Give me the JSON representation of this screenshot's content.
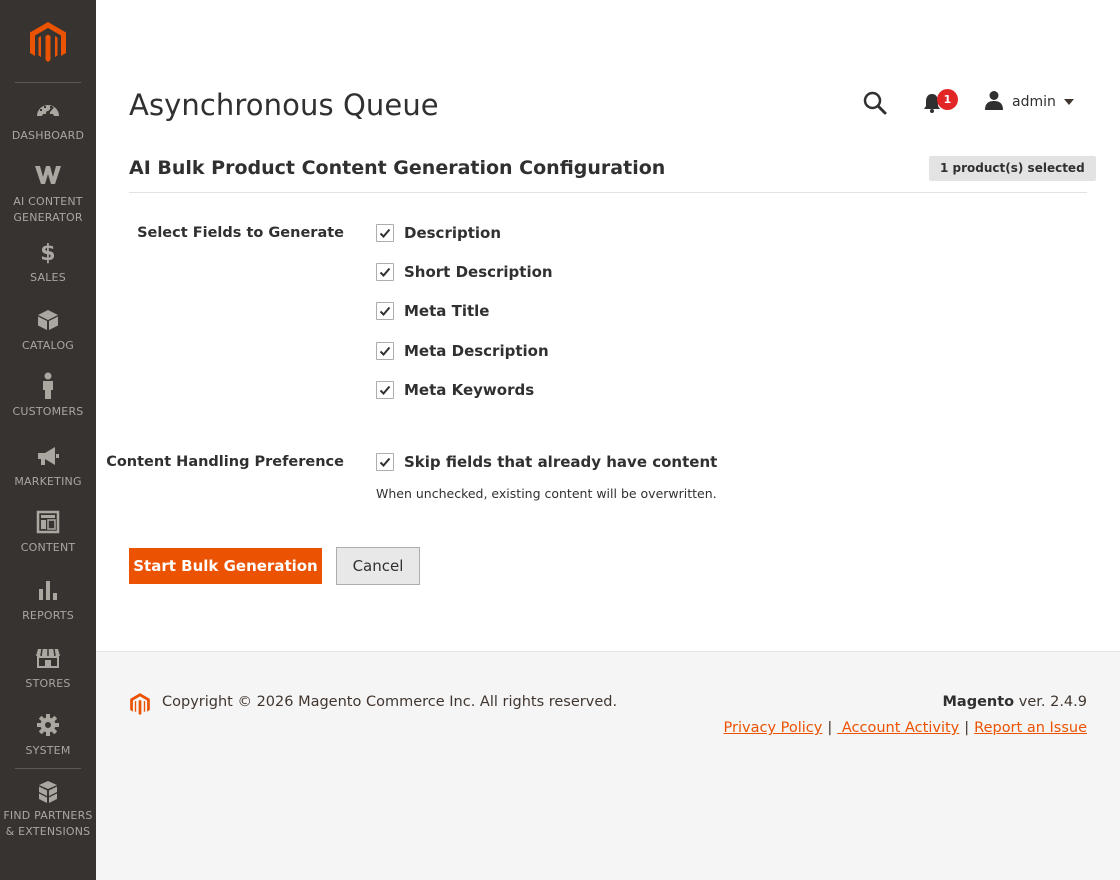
{
  "sidebar": {
    "items": [
      {
        "id": "dashboard",
        "label": "DASHBOARD",
        "icon": "dashboard-icon"
      },
      {
        "id": "ai-content",
        "label": "AI CONTENT\nGENERATOR",
        "icon": "w-logo-icon"
      },
      {
        "id": "sales",
        "label": "SALES",
        "icon": "dollar-icon"
      },
      {
        "id": "catalog",
        "label": "CATALOG",
        "icon": "cube-icon"
      },
      {
        "id": "customers",
        "label": "CUSTOMERS",
        "icon": "person-icon"
      },
      {
        "id": "marketing",
        "label": "MARKETING",
        "icon": "megaphone-icon"
      },
      {
        "id": "content",
        "label": "CONTENT",
        "icon": "layout-icon"
      },
      {
        "id": "reports",
        "label": "REPORTS",
        "icon": "bar-chart-icon"
      },
      {
        "id": "stores",
        "label": "STORES",
        "icon": "storefront-icon"
      },
      {
        "id": "system",
        "label": "SYSTEM",
        "icon": "gear-icon"
      },
      {
        "id": "partners",
        "label": "FIND PARTNERS\n& EXTENSIONS",
        "icon": "boxes-icon"
      }
    ]
  },
  "header": {
    "page_title": "Asynchronous Queue",
    "notification_count": "1",
    "username": "admin"
  },
  "section": {
    "title": "AI Bulk Product Content Generation Configuration",
    "selected_badge": "1 product(s) selected"
  },
  "form": {
    "fields_label": "Select Fields to Generate",
    "fields": [
      {
        "label": "Description",
        "checked": true
      },
      {
        "label": "Short Description",
        "checked": true
      },
      {
        "label": "Meta Title",
        "checked": true
      },
      {
        "label": "Meta Description",
        "checked": true
      },
      {
        "label": "Meta Keywords",
        "checked": true
      }
    ],
    "handling_label": "Content Handling Preference",
    "skip_label": "Skip fields that already have content",
    "skip_checked": true,
    "skip_note": "When unchecked, existing content will be overwritten.",
    "start_button": "Start Bulk Generation",
    "cancel_button": "Cancel"
  },
  "footer": {
    "copyright": "Copyright © 2026 Magento Commerce Inc. All rights reserved.",
    "brand": "Magento",
    "version": " ver. 2.4.9",
    "links": {
      "privacy": "Privacy Policy",
      "activity": " Account Activity",
      "report": "Report an Issue"
    },
    "separator": "|"
  },
  "colors": {
    "sidebar_bg": "#373330",
    "accent": "#eb5202",
    "badge_red": "#e22626"
  }
}
